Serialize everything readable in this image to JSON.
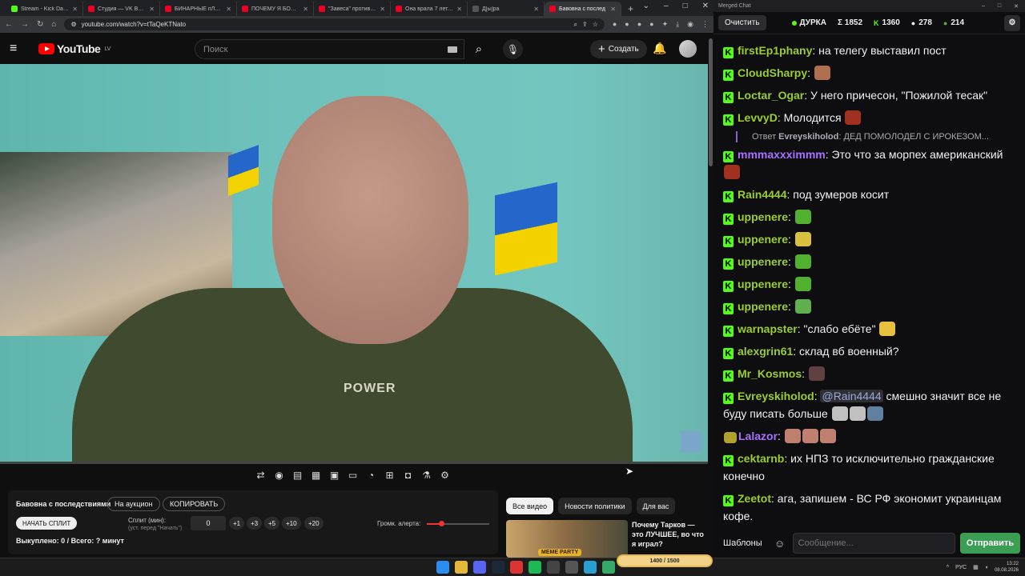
{
  "browser": {
    "tabs": [
      {
        "title": "Stream - Kick Dashboa",
        "color": "#53fc18"
      },
      {
        "title": "Студия — VK Видео |",
        "color": "#e02"
      },
      {
        "title": "БИНАРНЫЕ пЛОХОП",
        "color": "#e02"
      },
      {
        "title": "ПОЧЕМУ Я БОЛЬШЕ",
        "color": "#e02"
      },
      {
        "title": "\"Завеса\" против \"Ци",
        "color": "#e02"
      },
      {
        "title": "Она врала 7 лет. Тён",
        "color": "#e02"
      },
      {
        "title": "Д[ы]ра",
        "color": "#555"
      },
      {
        "title": "Бавовна с послед",
        "color": "#e02"
      }
    ],
    "new_tab": "+",
    "url": "youtube.com/watch?v=tTaQeKTNato"
  },
  "youtube": {
    "logo_text": "YouTube",
    "region": "LV",
    "search_placeholder": "Поиск",
    "create_label": "Создать"
  },
  "video": {
    "shirt_text": "POWER"
  },
  "split_panel": {
    "title": "Бавовна с последствиями",
    "auction_label": "На аукцион",
    "copy_label": "КОПИРОВАТЬ",
    "start_label": "НАЧАТЬ СПЛИТ",
    "split_label": "Сплит (мин):",
    "split_hint": "(уст. перед \"Начать\")",
    "split_value": "0",
    "steps": [
      "+1",
      "+3",
      "+5",
      "+10",
      "+20"
    ],
    "volume_label": "Громк. алерта:",
    "volume_fraction": 0.23,
    "bought_text": "Выкуплено: 0 / Всего: ? минут"
  },
  "filters": [
    "Все видео",
    "Новости политики",
    "Для вас"
  ],
  "recommendation": {
    "title": "Почему Тарков — это ЛУЧШЕЕ, во что я играл?",
    "badge": "MEME PARTY"
  },
  "chat": {
    "window_title": "Merged Chat",
    "clear_label": "Очистить",
    "channel": "ДУРКА",
    "stat1": "Σ 1852",
    "stat2": "1360",
    "stat3": "278",
    "stat4": "214",
    "messages": [
      {
        "user": "firstEp1phany",
        "color": "#9acd32",
        "text": "на телегу выставил пост",
        "emotes": []
      },
      {
        "user": "CloudSharpy",
        "color": "#9acd32",
        "text": "",
        "emotes": [
          "#b07050"
        ]
      },
      {
        "user": "Loctar_Ogar",
        "color": "#9acd32",
        "text": "У него причесон, \"Пожилой тесак\"",
        "emotes": []
      },
      {
        "user": "LevvyD",
        "color": "#9acd32",
        "text": "Молодится",
        "emotes": [
          "#a03020"
        ]
      },
      {
        "user": "mmmaxxximmm",
        "color": "#a970ff",
        "text": "Это что за морпех американский",
        "emotes": [
          "#a03020"
        ],
        "reply_prefix": "Ответ",
        "reply_user": "Evreyskiholod",
        "reply_text": "ДЕД ПОМОЛОДЕЛ С ИРОКЕЗОМ..."
      },
      {
        "user": "Rain4444",
        "color": "#9acd32",
        "text": "под зумеров косит",
        "emotes": []
      },
      {
        "user": "uppenere",
        "color": "#9acd32",
        "text": "",
        "emotes": [
          "#52b030"
        ]
      },
      {
        "user": "uppenere",
        "color": "#9acd32",
        "text": "",
        "emotes": [
          "#d8c040"
        ]
      },
      {
        "user": "uppenere",
        "color": "#9acd32",
        "text": "",
        "emotes": [
          "#52b030"
        ]
      },
      {
        "user": "uppenere",
        "color": "#9acd32",
        "text": "",
        "emotes": [
          "#52b030"
        ]
      },
      {
        "user": "uppenere",
        "color": "#9acd32",
        "text": "",
        "emotes": [
          "#60b050"
        ]
      },
      {
        "user": "warnapster",
        "color": "#9acd32",
        "text": "\"слабо ебёте\"",
        "emotes": [
          "#e8c040"
        ]
      },
      {
        "user": "alexgrin61",
        "color": "#9acd32",
        "text": "склад вб военный?",
        "emotes": []
      },
      {
        "user": "Mr_Kosmos",
        "color": "#9acd32",
        "text": "",
        "emotes": [
          "#604040"
        ]
      },
      {
        "user": "Evreyskiholod",
        "color": "#9acd32",
        "mention": "@Rain4444",
        "text": "смешно значит все не буду писать больше",
        "emotes": [
          "#c0c0c0",
          "#c0c0c0",
          "#6080a0"
        ]
      },
      {
        "user": "Lalazor",
        "color": "#a970ff",
        "text": "",
        "emotes": [
          "#c08070",
          "#c08070",
          "#c08070"
        ],
        "badge": "#b0a030"
      },
      {
        "user": "cektarnb",
        "color": "#9acd32",
        "text": "их НПЗ то исключительно гражданские конечно",
        "emotes": []
      },
      {
        "user": "Zeetot",
        "color": "#9acd32",
        "text": "ага, запишем - ВС РФ экономит украинцам кофе.",
        "emotes": []
      }
    ],
    "templates_label": "Шаблоны",
    "input_placeholder": "Сообщение...",
    "send_label": "Отправить"
  },
  "taskbar": {
    "lang": "РУС",
    "time": "13:22",
    "date": "08.08.2026",
    "kick_progress": "1400 / 1500"
  }
}
